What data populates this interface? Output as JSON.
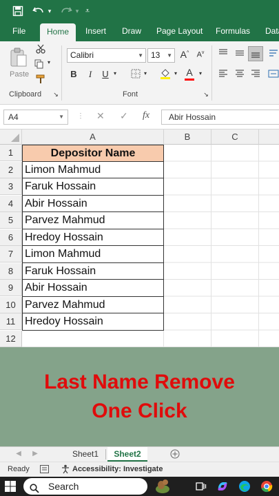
{
  "app": {
    "accent": "#217346"
  },
  "quick_access": {
    "save_icon": "save-icon",
    "undo_icon": "undo-icon",
    "redo_icon": "redo-icon",
    "customize_icon": "customize-icon"
  },
  "ribbon_tabs": [
    "File",
    "Home",
    "Insert",
    "Draw",
    "Page Layout",
    "Formulas",
    "Data"
  ],
  "clipboard": {
    "paste_label": "Paste",
    "group_label": "Clipboard"
  },
  "font": {
    "name": "Calibri",
    "size": "13",
    "group_label": "Font",
    "bold": "B",
    "italic": "I",
    "underline": "U",
    "grow": "A",
    "shrink": "A",
    "font_color": "A"
  },
  "formula_bar": {
    "name_box": "A4",
    "fx_label": "fx",
    "value": "Abir Hossain"
  },
  "columns": [
    "A",
    "B",
    "C"
  ],
  "rows": [
    "1",
    "2",
    "3",
    "4",
    "5",
    "6",
    "7",
    "8",
    "9",
    "10",
    "11",
    "12"
  ],
  "table": {
    "header": "Depositor Name",
    "header_color": "#f8cbad",
    "names": [
      "Limon Mahmud",
      "Faruk Hossain",
      "Abir Hossain",
      "Parvez Mahmud",
      "Hredoy Hossain",
      "Limon Mahmud",
      "Faruk Hossain",
      "Abir Hossain",
      "Parvez Mahmud",
      "Hredoy Hossain"
    ]
  },
  "banner": {
    "line1": "Last Name Remove",
    "line2": "One Click",
    "text_color": "#e00b0b",
    "bg_color": "#84a38a"
  },
  "sheets": {
    "tabs": [
      "Sheet1",
      "Sheet2"
    ],
    "active": "Sheet2",
    "add_label": "+"
  },
  "status": {
    "ready": "Ready",
    "accessibility": "Accessibility: Investigate"
  },
  "taskbar": {
    "search_placeholder": "Search"
  }
}
